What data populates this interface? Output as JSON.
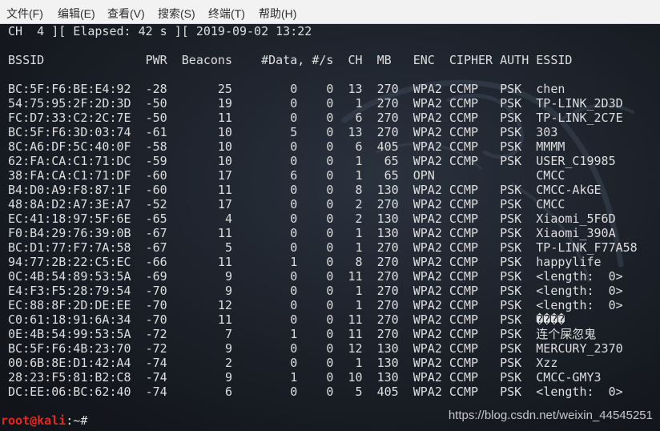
{
  "menu": {
    "items": [
      "文件(F)",
      "编辑(E)",
      "查看(V)",
      "搜索(S)",
      "终端(T)",
      "帮助(H)"
    ]
  },
  "terminal": {
    "status_line": "CH  4 ][ Elapsed: 42 s ][ 2019-09-02 13:22",
    "columns": {
      "bssid": "BSSID",
      "pwr": "PWR",
      "beacons": "Beacons",
      "data": "#Data,",
      "rate": "#/s",
      "ch": "CH",
      "mb": "MB",
      "enc": "ENC",
      "cipher": "CIPHER",
      "auth": "AUTH",
      "essid": "ESSID"
    },
    "access_points": [
      {
        "bssid": "BC:5F:F6:BE:E4:92",
        "pwr": "-28",
        "beacons": "25",
        "data": "0",
        "rate": "0",
        "ch": "13",
        "mb": "270",
        "enc": "WPA2",
        "cipher": "CCMP",
        "auth": "PSK",
        "essid": "chen"
      },
      {
        "bssid": "54:75:95:2F:2D:3D",
        "pwr": "-50",
        "beacons": "19",
        "data": "0",
        "rate": "0",
        "ch": "1",
        "mb": "270",
        "enc": "WPA2",
        "cipher": "CCMP",
        "auth": "PSK",
        "essid": "TP-LINK_2D3D"
      },
      {
        "bssid": "FC:D7:33:C2:2C:7E",
        "pwr": "-50",
        "beacons": "11",
        "data": "0",
        "rate": "0",
        "ch": "6",
        "mb": "270",
        "enc": "WPA2",
        "cipher": "CCMP",
        "auth": "PSK",
        "essid": "TP-LINK_2C7E"
      },
      {
        "bssid": "BC:5F:F6:3D:03:74",
        "pwr": "-61",
        "beacons": "10",
        "data": "5",
        "rate": "0",
        "ch": "13",
        "mb": "270",
        "enc": "WPA2",
        "cipher": "CCMP",
        "auth": "PSK",
        "essid": "303"
      },
      {
        "bssid": "8C:A6:DF:5C:40:0F",
        "pwr": "-58",
        "beacons": "10",
        "data": "0",
        "rate": "0",
        "ch": "6",
        "mb": "405",
        "enc": "WPA2",
        "cipher": "CCMP",
        "auth": "PSK",
        "essid": "MMMM"
      },
      {
        "bssid": "62:FA:CA:C1:71:DC",
        "pwr": "-59",
        "beacons": "10",
        "data": "0",
        "rate": "0",
        "ch": "1",
        "mb": "65",
        "enc": "WPA2",
        "cipher": "CCMP",
        "auth": "PSK",
        "essid": "USER_C19985"
      },
      {
        "bssid": "38:FA:CA:C1:71:DF",
        "pwr": "-60",
        "beacons": "17",
        "data": "6",
        "rate": "0",
        "ch": "1",
        "mb": "65",
        "enc": "OPN",
        "essid": "CMCC"
      },
      {
        "bssid": "B4:D0:A9:F8:87:1F",
        "pwr": "-60",
        "beacons": "11",
        "data": "0",
        "rate": "0",
        "ch": "8",
        "mb": "130",
        "enc": "WPA2",
        "cipher": "CCMP",
        "auth": "PSK",
        "essid": "CMCC-AkGE"
      },
      {
        "bssid": "48:8A:D2:A7:3E:A7",
        "pwr": "-52",
        "beacons": "17",
        "data": "0",
        "rate": "0",
        "ch": "2",
        "mb": "270",
        "enc": "WPA2",
        "cipher": "CCMP",
        "auth": "PSK",
        "essid": "CMCC"
      },
      {
        "bssid": "EC:41:18:97:5F:6E",
        "pwr": "-65",
        "beacons": "4",
        "data": "0",
        "rate": "0",
        "ch": "2",
        "mb": "130",
        "enc": "WPA2",
        "cipher": "CCMP",
        "auth": "PSK",
        "essid": "Xiaomi_5F6D"
      },
      {
        "bssid": "F0:B4:29:76:39:0B",
        "pwr": "-67",
        "beacons": "11",
        "data": "0",
        "rate": "0",
        "ch": "1",
        "mb": "130",
        "enc": "WPA2",
        "cipher": "CCMP",
        "auth": "PSK",
        "essid": "Xiaomi_390A"
      },
      {
        "bssid": "BC:D1:77:F7:7A:58",
        "pwr": "-67",
        "beacons": "5",
        "data": "0",
        "rate": "0",
        "ch": "1",
        "mb": "270",
        "enc": "WPA2",
        "cipher": "CCMP",
        "auth": "PSK",
        "essid": "TP-LINK_F77A58"
      },
      {
        "bssid": "94:77:2B:22:C5:EC",
        "pwr": "-66",
        "beacons": "11",
        "data": "1",
        "rate": "0",
        "ch": "8",
        "mb": "270",
        "enc": "WPA2",
        "cipher": "CCMP",
        "auth": "PSK",
        "essid": "happylife"
      },
      {
        "bssid": "0C:4B:54:89:53:5A",
        "pwr": "-69",
        "beacons": "9",
        "data": "0",
        "rate": "0",
        "ch": "11",
        "mb": "270",
        "enc": "WPA2",
        "cipher": "CCMP",
        "auth": "PSK",
        "essid": "<length:  0>"
      },
      {
        "bssid": "E4:F3:F5:28:79:54",
        "pwr": "-70",
        "beacons": "9",
        "data": "0",
        "rate": "0",
        "ch": "1",
        "mb": "270",
        "enc": "WPA2",
        "cipher": "CCMP",
        "auth": "PSK",
        "essid": "<length:  0>"
      },
      {
        "bssid": "EC:88:8F:2D:DE:EE",
        "pwr": "-70",
        "beacons": "12",
        "data": "0",
        "rate": "0",
        "ch": "1",
        "mb": "270",
        "enc": "WPA2",
        "cipher": "CCMP",
        "auth": "PSK",
        "essid": "<length:  0>"
      },
      {
        "bssid": "C0:61:18:91:6A:34",
        "pwr": "-70",
        "beacons": "11",
        "data": "0",
        "rate": "0",
        "ch": "11",
        "mb": "270",
        "enc": "WPA2",
        "cipher": "CCMP",
        "auth": "PSK",
        "essid": "����"
      },
      {
        "bssid": "0E:4B:54:99:53:5A",
        "pwr": "-72",
        "beacons": "7",
        "data": "1",
        "rate": "0",
        "ch": "11",
        "mb": "270",
        "enc": "WPA2",
        "cipher": "CCMP",
        "auth": "PSK",
        "essid": "连个屎忽鬼"
      },
      {
        "bssid": "BC:5F:F6:4B:23:70",
        "pwr": "-72",
        "beacons": "9",
        "data": "0",
        "rate": "0",
        "ch": "12",
        "mb": "130",
        "enc": "WPA2",
        "cipher": "CCMP",
        "auth": "PSK",
        "essid": "MERCURY_2370"
      },
      {
        "bssid": "00:6B:8E:D1:42:A4",
        "pwr": "-74",
        "beacons": "2",
        "data": "0",
        "rate": "0",
        "ch": "1",
        "mb": "130",
        "enc": "WPA2",
        "cipher": "CCMP",
        "auth": "PSK",
        "essid": "Xzz"
      },
      {
        "bssid": "28:23:F5:81:B2:C8",
        "pwr": "-74",
        "beacons": "9",
        "data": "1",
        "rate": "0",
        "ch": "10",
        "mb": "130",
        "enc": "WPA2",
        "cipher": "CCMP",
        "auth": "PSK",
        "essid": "CMCC-GMY3"
      },
      {
        "bssid": "DC:EE:06:BC:62:40",
        "pwr": "-74",
        "beacons": "6",
        "data": "0",
        "rate": "0",
        "ch": "5",
        "mb": "405",
        "enc": "WPA2",
        "cipher": "CCMP",
        "auth": "PSK",
        "essid": "<length:  0>"
      }
    ],
    "prompt": {
      "user_host": "root@kali",
      "path_symbol": ":~#"
    }
  },
  "watermark": "https://blog.csdn.net/weixin_44545251",
  "colors": {
    "terminal_text": "#dedede",
    "prompt_user": "#e8271f",
    "menu_background": "#f2f2f2"
  }
}
